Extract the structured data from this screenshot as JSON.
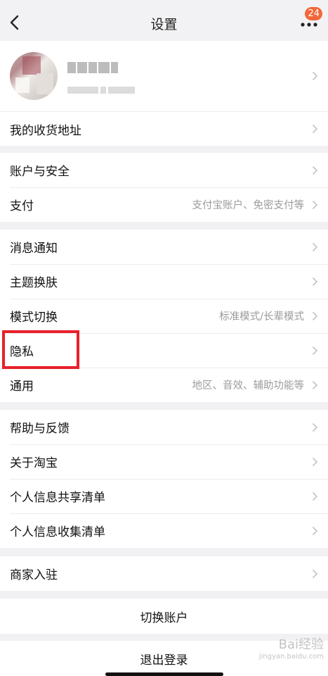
{
  "nav": {
    "title": "设置",
    "badge": "24"
  },
  "profile": {},
  "sections": [
    {
      "rows": [
        {
          "label": "我的收货地址"
        }
      ]
    },
    {
      "rows": [
        {
          "label": "账户与安全"
        },
        {
          "label": "支付",
          "value": "支付宝账户、免密支付等"
        }
      ]
    },
    {
      "rows": [
        {
          "label": "消息通知"
        },
        {
          "label": "主题换肤"
        },
        {
          "label": "模式切换",
          "value": "标准模式/长辈模式"
        },
        {
          "label": "隐私"
        },
        {
          "label": "通用",
          "value": "地区、音效、辅助功能等"
        }
      ]
    },
    {
      "rows": [
        {
          "label": "帮助与反馈"
        },
        {
          "label": "关于淘宝"
        },
        {
          "label": "个人信息共享清单"
        },
        {
          "label": "个人信息收集清单"
        }
      ]
    },
    {
      "rows": [
        {
          "label": "商家入驻"
        }
      ]
    }
  ],
  "buttons": {
    "switch_account": "切换账户",
    "logout": "退出登录"
  },
  "watermark": {
    "text": "Bai经验",
    "sub": "jingyan.baidu.com"
  },
  "colors": {
    "accent": "#f2673a",
    "highlight": "#e8202b"
  }
}
